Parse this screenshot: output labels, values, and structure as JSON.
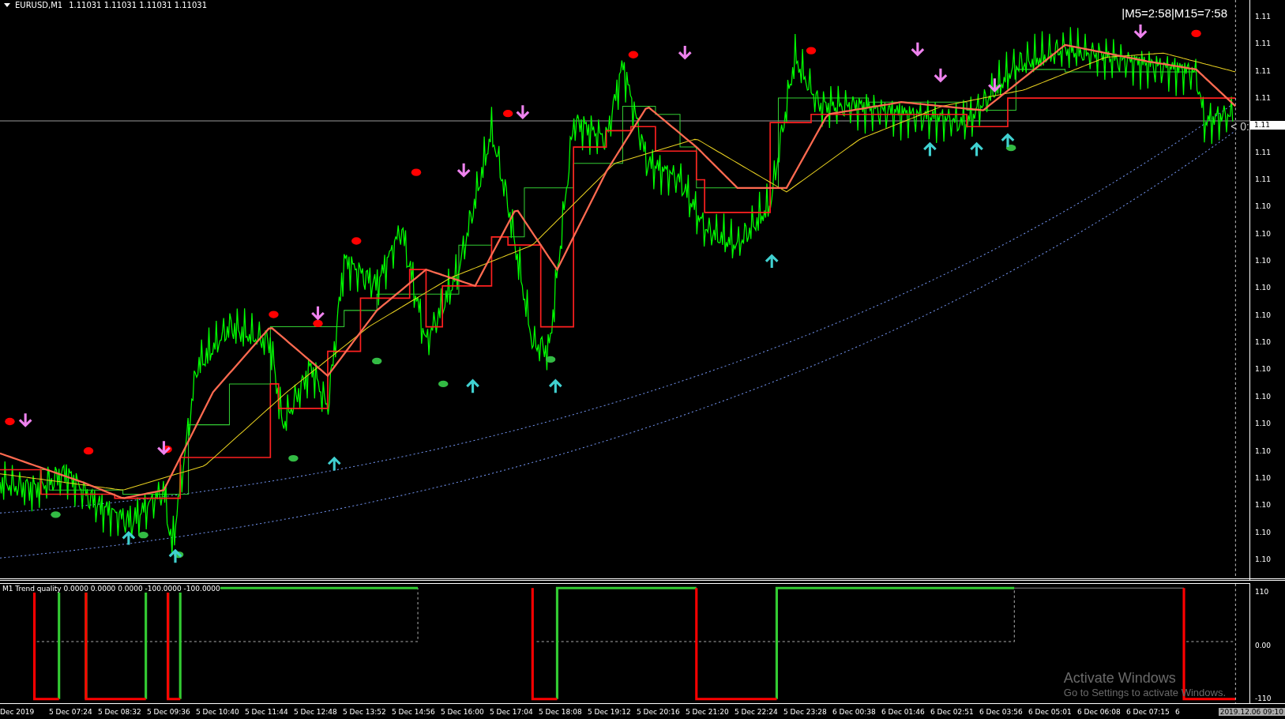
{
  "chart": {
    "symbol": "EURUSD,M1",
    "prices": "1.11031 1.11031 1.11031 1.11031",
    "timer": "|M5=2:58|M15=7:58",
    "price_line_label": "< 0:"
  },
  "price_axis": [
    {
      "text": "1.11",
      "kind": "tick"
    },
    {
      "text": "1.11",
      "kind": "tick"
    },
    {
      "text": "1.11",
      "kind": "tick"
    },
    {
      "text": "1.11",
      "kind": "tick"
    },
    {
      "text": "1.11",
      "kind": "current"
    },
    {
      "text": "1.11",
      "kind": "tick"
    },
    {
      "text": "1.11",
      "kind": "tick"
    },
    {
      "text": "1.10",
      "kind": "tick"
    },
    {
      "text": "1.10",
      "kind": "tick"
    },
    {
      "text": "1.10",
      "kind": "tick"
    },
    {
      "text": "1.10",
      "kind": "tick"
    },
    {
      "text": "1.10",
      "kind": "tick"
    },
    {
      "text": "1.10",
      "kind": "tick"
    },
    {
      "text": "1.10",
      "kind": "tick"
    },
    {
      "text": "1.10",
      "kind": "tick"
    },
    {
      "text": "1.10",
      "kind": "tick"
    },
    {
      "text": "1.10",
      "kind": "tick"
    },
    {
      "text": "1.10",
      "kind": "tick"
    },
    {
      "text": "1.10",
      "kind": "tick"
    },
    {
      "text": "1.10",
      "kind": "tick"
    },
    {
      "text": "1.10",
      "kind": "tick"
    }
  ],
  "indicator": {
    "label": "M1 Trend quality 0.0000 0.0000 0.0000 -100.0000 -100.0000",
    "axis": [
      "110",
      "0.00",
      "-110"
    ]
  },
  "time_axis": [
    "Dec 2019",
    "5 Dec 07:24",
    "5 Dec 08:32",
    "5 Dec 09:36",
    "5 Dec 10:40",
    "5 Dec 11:44",
    "5 Dec 12:48",
    "5 Dec 13:52",
    "5 Dec 14:56",
    "5 Dec 16:00",
    "5 Dec 17:04",
    "5 Dec 18:08",
    "5 Dec 19:12",
    "5 Dec 20:16",
    "5 Dec 21:20",
    "5 Dec 22:24",
    "5 Dec 23:28",
    "6 Dec 00:38",
    "6 Dec 01:46",
    "6 Dec 02:51",
    "6 Dec 03:56",
    "6 Dec 05:01",
    "6 Dec 06:08",
    "6 Dec 07:15",
    "6"
  ],
  "cursor_time": "2019.12.06 09:10",
  "activation": {
    "title": "Activate Windows",
    "message": "Go to Settings to activate Windows."
  }
}
